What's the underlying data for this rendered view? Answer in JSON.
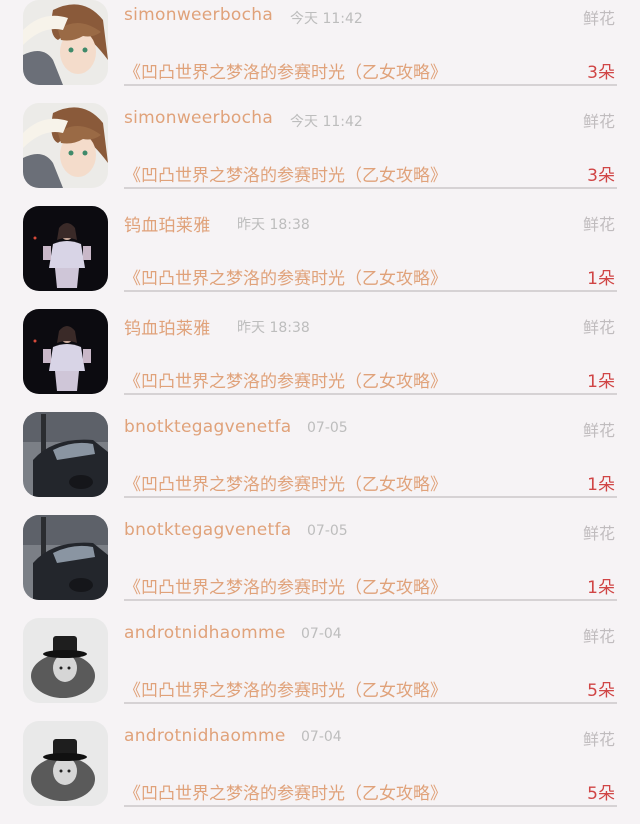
{
  "items": [
    {
      "username": "simonweerbocha",
      "time": "今天 11:42",
      "gift": "鲜花",
      "title": "《凹凸世界之梦洛的参赛时光（乙女攻略》",
      "count": "3朵",
      "avatar": "anime-boy"
    },
    {
      "username": "simonweerbocha",
      "time": "今天 11:42",
      "gift": "鲜花",
      "title": "《凹凸世界之梦洛的参赛时光（乙女攻略》",
      "count": "3朵",
      "avatar": "anime-boy"
    },
    {
      "username": "钨血珀莱雅",
      "time": "昨天 18:38",
      "gift": "鲜花",
      "title": "《凹凸世界之梦洛的参赛时光（乙女攻略》",
      "count": "1朵",
      "avatar": "night-girl"
    },
    {
      "username": "钨血珀莱雅",
      "time": "昨天 18:38",
      "gift": "鲜花",
      "title": "《凹凸世界之梦洛的参赛时光（乙女攻略》",
      "count": "1朵",
      "avatar": "night-girl"
    },
    {
      "username": "bnotktegagvenetfa",
      "time": "07-05",
      "gift": "鲜花",
      "title": "《凹凸世界之梦洛的参赛时光（乙女攻略》",
      "count": "1朵",
      "avatar": "car"
    },
    {
      "username": "bnotktegagvenetfa",
      "time": "07-05",
      "gift": "鲜花",
      "title": "《凹凸世界之梦洛的参赛时光（乙女攻略》",
      "count": "1朵",
      "avatar": "car"
    },
    {
      "username": "androtnidhaomme",
      "time": "07-04",
      "gift": "鲜花",
      "title": "《凹凸世界之梦洛的参赛时光（乙女攻略》",
      "count": "5朵",
      "avatar": "hat-person"
    },
    {
      "username": "androtnidhaomme",
      "time": "07-04",
      "gift": "鲜花",
      "title": "《凹凸世界之梦洛的参赛时光（乙女攻略》",
      "count": "5朵",
      "avatar": "hat-person"
    }
  ]
}
